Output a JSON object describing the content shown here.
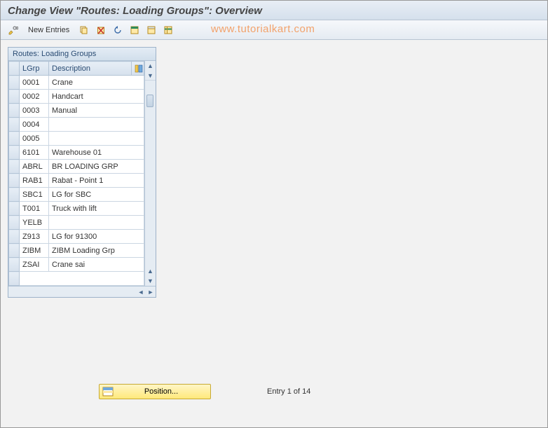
{
  "title": "Change View \"Routes: Loading Groups\": Overview",
  "watermark": "www.tutorialkart.com",
  "toolbar": {
    "new_entries_label": "New Entries"
  },
  "panel": {
    "header": "Routes: Loading Groups",
    "columns": {
      "lgrp": "LGrp",
      "description": "Description"
    },
    "rows": [
      {
        "lgrp": "0001",
        "desc": "Crane"
      },
      {
        "lgrp": "0002",
        "desc": "Handcart"
      },
      {
        "lgrp": "0003",
        "desc": "Manual"
      },
      {
        "lgrp": "0004",
        "desc": ""
      },
      {
        "lgrp": "0005",
        "desc": ""
      },
      {
        "lgrp": "6101",
        "desc": "Warehouse 01"
      },
      {
        "lgrp": "ABRL",
        "desc": "BR LOADING GRP"
      },
      {
        "lgrp": "RAB1",
        "desc": "Rabat - Point 1"
      },
      {
        "lgrp": "SBC1",
        "desc": "LG for SBC"
      },
      {
        "lgrp": "T001",
        "desc": "Truck with lift"
      },
      {
        "lgrp": "YELB",
        "desc": ""
      },
      {
        "lgrp": "Z913",
        "desc": "LG for  91300"
      },
      {
        "lgrp": "ZIBM",
        "desc": "ZIBM Loading Grp"
      },
      {
        "lgrp": "ZSAI",
        "desc": "Crane sai"
      }
    ]
  },
  "footer": {
    "position_label": "Position...",
    "entry_text": "Entry 1 of 14"
  }
}
